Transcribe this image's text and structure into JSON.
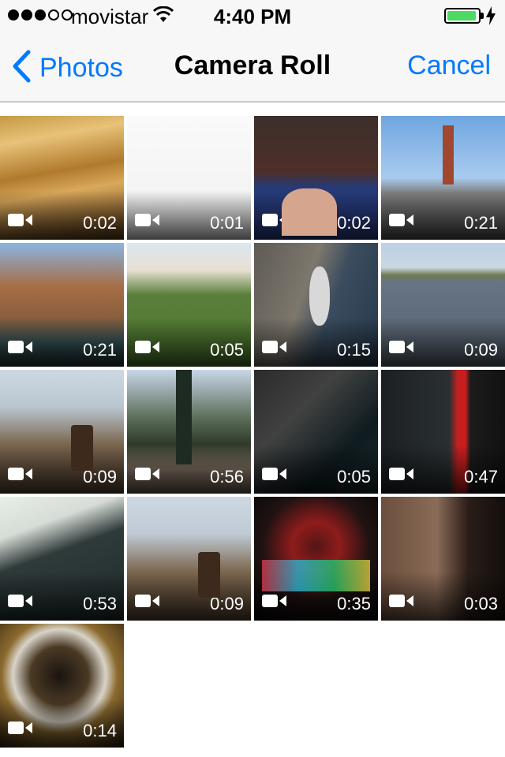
{
  "status_bar": {
    "carrier": "movistar",
    "time": "4:40 PM",
    "signal_bars_filled": 3,
    "signal_bars_total": 5,
    "battery_level": 0.95,
    "charging": true,
    "battery_color": "#4cd964"
  },
  "nav": {
    "back_label": "Photos",
    "title": "Camera Roll",
    "cancel_label": "Cancel",
    "accent_color": "#007aff"
  },
  "videos": [
    {
      "duration": "0:02",
      "icon": "video-camera-icon"
    },
    {
      "duration": "0:01",
      "icon": "video-camera-icon"
    },
    {
      "duration": "0:02",
      "icon": "video-camera-icon"
    },
    {
      "duration": "0:21",
      "icon": "video-camera-icon"
    },
    {
      "duration": "0:21",
      "icon": "video-camera-icon"
    },
    {
      "duration": "0:05",
      "icon": "video-camera-icon"
    },
    {
      "duration": "0:15",
      "icon": "video-camera-icon"
    },
    {
      "duration": "0:09",
      "icon": "video-camera-icon"
    },
    {
      "duration": "0:09",
      "icon": "video-camera-icon"
    },
    {
      "duration": "0:56",
      "icon": "video-camera-icon"
    },
    {
      "duration": "0:05",
      "icon": "video-camera-icon"
    },
    {
      "duration": "0:47",
      "icon": "video-camera-icon"
    },
    {
      "duration": "0:53",
      "icon": "video-camera-icon"
    },
    {
      "duration": "0:09",
      "icon": "video-camera-icon"
    },
    {
      "duration": "0:35",
      "icon": "video-camera-icon"
    },
    {
      "duration": "0:03",
      "icon": "video-camera-icon"
    },
    {
      "duration": "0:14",
      "icon": "video-camera-icon"
    }
  ]
}
